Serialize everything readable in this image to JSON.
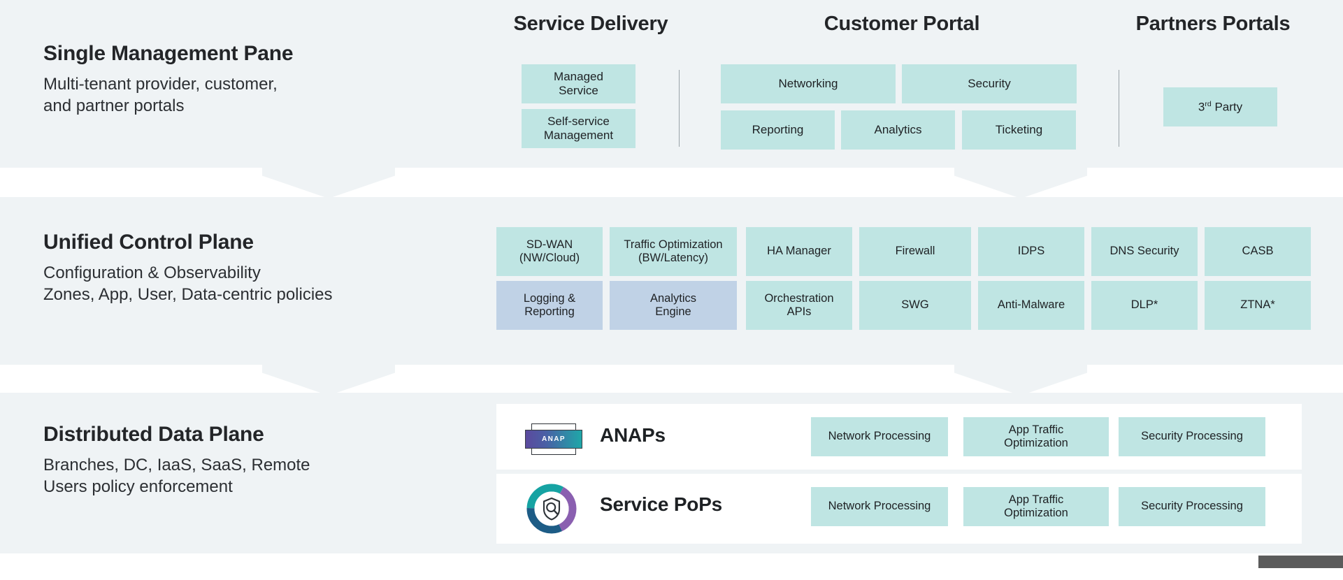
{
  "colors": {
    "band_bg": "#eff3f5",
    "chip_teal": "#bfe5e3",
    "chip_blue": "#c0d2e6",
    "panel_white": "#ffffff",
    "text_dark": "#232528",
    "rule": "#9aa3a8",
    "bottom_bar": "#5b5b5b",
    "anap_gradient_start": "#5b4a9e",
    "anap_gradient_end": "#1fa7a8",
    "pop_ring_teal": "#16a3a3",
    "pop_ring_purple": "#8a5fb0",
    "pop_ring_navy": "#1d5c86"
  },
  "bands": [
    {
      "id": "management",
      "title": "Single Management Pane",
      "subtitle": "Multi-tenant provider, customer,\nand partner portals",
      "columns": [
        {
          "header": "Service Delivery",
          "rows": [
            [
              "Managed\nService"
            ],
            [
              "Self-service\nManagement"
            ]
          ]
        },
        {
          "header": "Customer Portal",
          "rows": [
            [
              "Networking",
              "Security"
            ],
            [
              "Reporting",
              "Analytics",
              "Ticketing"
            ]
          ]
        },
        {
          "header": "Partners Portals",
          "rows": [
            [
              "3rd Party"
            ]
          ]
        }
      ]
    },
    {
      "id": "control",
      "title": "Unified Control Plane",
      "subtitle": "Configuration & Observability\nZones, App, User, Data-centric policies",
      "grid": {
        "row1": [
          {
            "label": "SD-WAN\n(NW/Cloud)",
            "style": "teal"
          },
          {
            "label": "Traffic Optimization\n(BW/Latency)",
            "style": "teal"
          },
          {
            "label": "HA Manager",
            "style": "teal"
          },
          {
            "label": "Firewall",
            "style": "teal"
          },
          {
            "label": "IDPS",
            "style": "teal"
          },
          {
            "label": "DNS Security",
            "style": "teal"
          },
          {
            "label": "CASB",
            "style": "teal"
          }
        ],
        "row2": [
          {
            "label": "Logging &\nReporting",
            "style": "blue"
          },
          {
            "label": "Analytics\nEngine",
            "style": "blue"
          },
          {
            "label": "Orchestration\nAPIs",
            "style": "teal"
          },
          {
            "label": "SWG",
            "style": "teal"
          },
          {
            "label": "Anti-Malware",
            "style": "teal"
          },
          {
            "label": "DLP*",
            "style": "teal"
          },
          {
            "label": "ZTNA*",
            "style": "teal"
          }
        ]
      }
    },
    {
      "id": "data",
      "title": "Distributed Data Plane",
      "subtitle": "Branches, DC, IaaS, SaaS, Remote\nUsers policy enforcement",
      "rows": [
        {
          "icon": "anap-logo-icon",
          "icon_text": "ANAP",
          "label": "ANAPs",
          "chips": [
            "Network Processing",
            "App Traffic\nOptimization",
            "Security Processing"
          ]
        },
        {
          "icon": "service-pop-shield-icon",
          "icon_text": "",
          "label": "Service PoPs",
          "chips": [
            "Network Processing",
            "App Traffic\nOptimization",
            "Security Processing"
          ]
        }
      ]
    }
  ]
}
